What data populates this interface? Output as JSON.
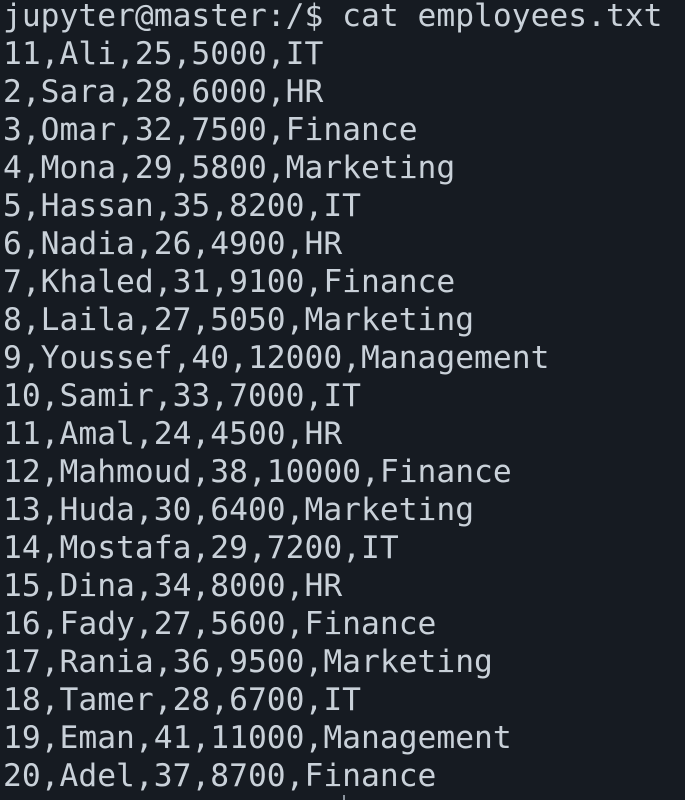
{
  "terminal": {
    "prompt": "jupyter@master:/$ cat employees.txt",
    "lines": [
      "11,Ali,25,5000,IT",
      "2,Sara,28,6000,HR",
      "3,Omar,32,7500,Finance",
      "4,Mona,29,5800,Marketing",
      "5,Hassan,35,8200,IT",
      "6,Nadia,26,4900,HR",
      "7,Khaled,31,9100,Finance",
      "8,Laila,27,5050,Marketing",
      "9,Youssef,40,12000,Management",
      "10,Samir,33,7000,IT",
      "11,Amal,24,4500,HR",
      "12,Mahmoud,38,10000,Finance",
      "13,Huda,30,6400,Marketing",
      "14,Mostafa,29,7200,IT",
      "15,Dina,34,8000,HR",
      "16,Fady,27,5600,Finance",
      "17,Rania,36,9500,Marketing",
      "18,Tamer,28,6700,IT",
      "19,Eman,41,11000,Management",
      "20,Adel,37,8700,Finance"
    ],
    "colors": {
      "background": "#161b22",
      "text": "#c9d1d9"
    }
  }
}
